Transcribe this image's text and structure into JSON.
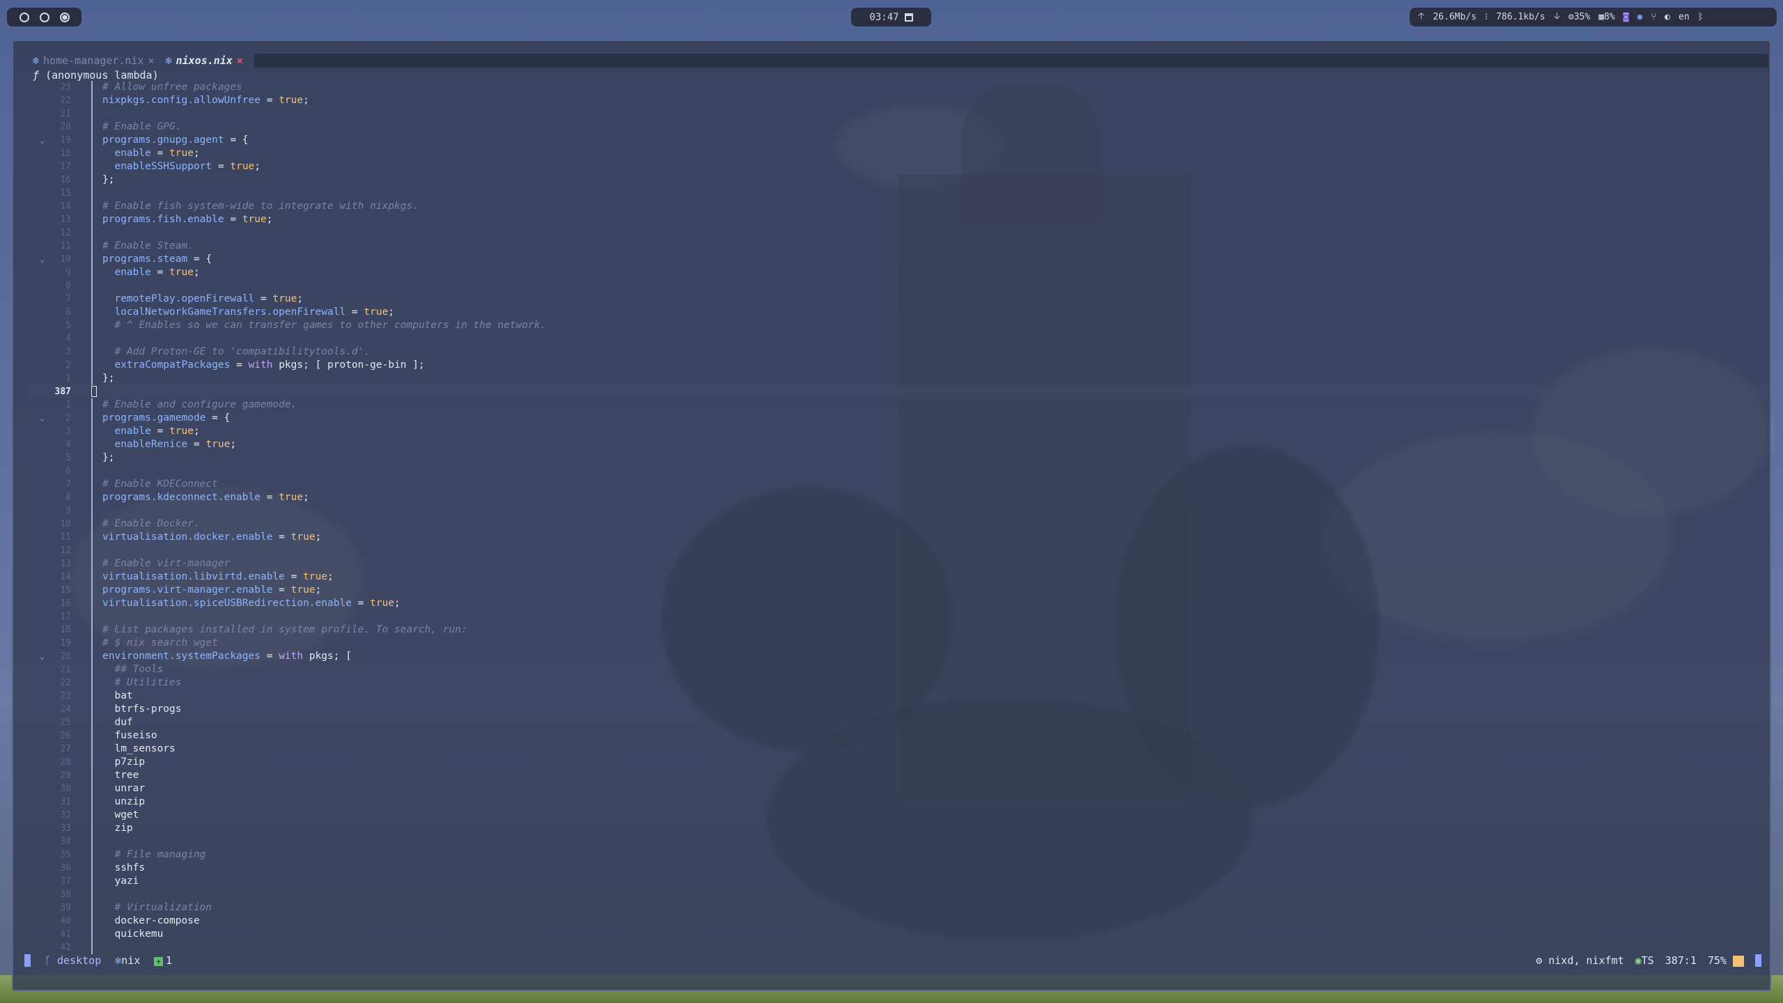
{
  "topbar": {
    "workspaces": [
      "1",
      "2",
      "3"
    ],
    "clock": "03:47",
    "net_up": "26.6Mb/s",
    "net_down": "786.1kb/s",
    "cpu": "35%",
    "mem": "8%",
    "lang": "en"
  },
  "editor": {
    "tabs": [
      {
        "label": "home-manager.nix",
        "close": "×",
        "active": false
      },
      {
        "label": "nixos.nix",
        "close": "×",
        "active": true
      }
    ],
    "winbar_fn": "ƒ",
    "winbar": "(anonymous lambda)",
    "lines": [
      {
        "n": "23",
        "t": [
          [
            "c",
            "# Allow unfree packages"
          ]
        ]
      },
      {
        "n": "22",
        "t": [
          [
            "a",
            "nixpkgs.config.allowUnfree"
          ],
          [
            "o",
            " = "
          ],
          [
            "b",
            "true"
          ],
          [
            "o",
            ";"
          ]
        ]
      },
      {
        "n": "21",
        "t": []
      },
      {
        "n": "20",
        "t": [
          [
            "c",
            "# Enable GPG."
          ]
        ]
      },
      {
        "n": "19",
        "fold": true,
        "t": [
          [
            "a",
            "programs.gnupg.agent"
          ],
          [
            "o",
            " = {"
          ]
        ]
      },
      {
        "n": "18",
        "t": [
          [
            "o",
            "  "
          ],
          [
            "a",
            "enable"
          ],
          [
            "o",
            " = "
          ],
          [
            "b",
            "true"
          ],
          [
            "o",
            ";"
          ]
        ]
      },
      {
        "n": "17",
        "t": [
          [
            "o",
            "  "
          ],
          [
            "a",
            "enableSSHSupport"
          ],
          [
            "o",
            " = "
          ],
          [
            "b",
            "true"
          ],
          [
            "o",
            ";"
          ]
        ]
      },
      {
        "n": "16",
        "t": [
          [
            "o",
            "};"
          ]
        ]
      },
      {
        "n": "15",
        "t": []
      },
      {
        "n": "14",
        "t": [
          [
            "c",
            "# Enable fish system-wide to integrate with nixpkgs."
          ]
        ]
      },
      {
        "n": "13",
        "t": [
          [
            "a",
            "programs.fish.enable"
          ],
          [
            "o",
            " = "
          ],
          [
            "b",
            "true"
          ],
          [
            "o",
            ";"
          ]
        ]
      },
      {
        "n": "12",
        "t": []
      },
      {
        "n": "11",
        "t": [
          [
            "c",
            "# Enable Steam."
          ]
        ]
      },
      {
        "n": "10",
        "fold": true,
        "t": [
          [
            "a",
            "programs.steam"
          ],
          [
            "o",
            " = {"
          ]
        ]
      },
      {
        "n": "9",
        "t": [
          [
            "o",
            "  "
          ],
          [
            "a",
            "enable"
          ],
          [
            "o",
            " = "
          ],
          [
            "b",
            "true"
          ],
          [
            "o",
            ";"
          ]
        ]
      },
      {
        "n": "8",
        "t": []
      },
      {
        "n": "7",
        "t": [
          [
            "o",
            "  "
          ],
          [
            "a",
            "remotePlay.openFirewall"
          ],
          [
            "o",
            " = "
          ],
          [
            "b",
            "true"
          ],
          [
            "o",
            ";"
          ]
        ]
      },
      {
        "n": "6",
        "t": [
          [
            "o",
            "  "
          ],
          [
            "a",
            "localNetworkGameTransfers.openFirewall"
          ],
          [
            "o",
            " = "
          ],
          [
            "b",
            "true"
          ],
          [
            "o",
            ";"
          ]
        ]
      },
      {
        "n": "5",
        "t": [
          [
            "o",
            "  "
          ],
          [
            "c",
            "# ^ Enables so we can transfer games to other computers in the network."
          ]
        ]
      },
      {
        "n": "4",
        "t": []
      },
      {
        "n": "3",
        "t": [
          [
            "o",
            "  "
          ],
          [
            "c",
            "# Add Proton-GE to 'compatibilitytools.d'."
          ]
        ]
      },
      {
        "n": "2",
        "t": [
          [
            "o",
            "  "
          ],
          [
            "a",
            "extraCompatPackages"
          ],
          [
            "o",
            " = "
          ],
          [
            "k",
            "with"
          ],
          [
            "o",
            " pkgs; [ proton-ge-bin ];"
          ]
        ]
      },
      {
        "n": "1",
        "t": [
          [
            "o",
            "};"
          ]
        ]
      },
      {
        "n": "387",
        "current": true,
        "t": []
      },
      {
        "n": "1",
        "t": [
          [
            "c",
            "# Enable and configure gamemode."
          ]
        ]
      },
      {
        "n": "2",
        "fold": true,
        "t": [
          [
            "a",
            "programs.gamemode"
          ],
          [
            "o",
            " = {"
          ]
        ]
      },
      {
        "n": "3",
        "t": [
          [
            "o",
            "  "
          ],
          [
            "a",
            "enable"
          ],
          [
            "o",
            " = "
          ],
          [
            "b",
            "true"
          ],
          [
            "o",
            ";"
          ]
        ]
      },
      {
        "n": "4",
        "t": [
          [
            "o",
            "  "
          ],
          [
            "a",
            "enableRenice"
          ],
          [
            "o",
            " = "
          ],
          [
            "b",
            "true"
          ],
          [
            "o",
            ";"
          ]
        ]
      },
      {
        "n": "5",
        "t": [
          [
            "o",
            "};"
          ]
        ]
      },
      {
        "n": "6",
        "t": []
      },
      {
        "n": "7",
        "t": [
          [
            "c",
            "# Enable KDEConnect"
          ]
        ]
      },
      {
        "n": "8",
        "t": [
          [
            "a",
            "programs.kdeconnect.enable"
          ],
          [
            "o",
            " = "
          ],
          [
            "b",
            "true"
          ],
          [
            "o",
            ";"
          ]
        ]
      },
      {
        "n": "9",
        "t": []
      },
      {
        "n": "10",
        "t": [
          [
            "c",
            "# Enable Docker."
          ]
        ]
      },
      {
        "n": "11",
        "t": [
          [
            "a",
            "virtualisation.docker.enable"
          ],
          [
            "o",
            " = "
          ],
          [
            "b",
            "true"
          ],
          [
            "o",
            ";"
          ]
        ]
      },
      {
        "n": "12",
        "t": []
      },
      {
        "n": "13",
        "t": [
          [
            "c",
            "# Enable virt-manager"
          ]
        ]
      },
      {
        "n": "14",
        "t": [
          [
            "a",
            "virtualisation.libvirtd.enable"
          ],
          [
            "o",
            " = "
          ],
          [
            "b",
            "true"
          ],
          [
            "o",
            ";"
          ]
        ]
      },
      {
        "n": "15",
        "t": [
          [
            "a",
            "programs.virt-manager.enable"
          ],
          [
            "o",
            " = "
          ],
          [
            "b",
            "true"
          ],
          [
            "o",
            ";"
          ]
        ]
      },
      {
        "n": "16",
        "t": [
          [
            "a",
            "virtualisation.spiceUSBRedirection.enable"
          ],
          [
            "o",
            " = "
          ],
          [
            "b",
            "true"
          ],
          [
            "o",
            ";"
          ]
        ]
      },
      {
        "n": "17",
        "t": []
      },
      {
        "n": "18",
        "t": [
          [
            "c",
            "# List packages installed in system profile. To search, run:"
          ]
        ]
      },
      {
        "n": "19",
        "t": [
          [
            "c",
            "# $ nix search wget"
          ]
        ]
      },
      {
        "n": "20",
        "fold": true,
        "t": [
          [
            "a",
            "environment.systemPackages"
          ],
          [
            "o",
            " = "
          ],
          [
            "k",
            "with"
          ],
          [
            "o",
            " pkgs; ["
          ]
        ]
      },
      {
        "n": "21",
        "t": [
          [
            "o",
            "  "
          ],
          [
            "c",
            "## Tools"
          ]
        ]
      },
      {
        "n": "22",
        "t": [
          [
            "o",
            "  "
          ],
          [
            "c",
            "# Utilities"
          ]
        ]
      },
      {
        "n": "23",
        "t": [
          [
            "o",
            "  bat"
          ]
        ]
      },
      {
        "n": "24",
        "t": [
          [
            "o",
            "  btrfs-progs"
          ]
        ]
      },
      {
        "n": "25",
        "t": [
          [
            "o",
            "  duf"
          ]
        ]
      },
      {
        "n": "26",
        "t": [
          [
            "o",
            "  fuseiso"
          ]
        ]
      },
      {
        "n": "27",
        "t": [
          [
            "o",
            "  lm_sensors"
          ]
        ]
      },
      {
        "n": "28",
        "t": [
          [
            "o",
            "  p7zip"
          ]
        ]
      },
      {
        "n": "29",
        "t": [
          [
            "o",
            "  tree"
          ]
        ]
      },
      {
        "n": "30",
        "t": [
          [
            "o",
            "  unrar"
          ]
        ]
      },
      {
        "n": "31",
        "t": [
          [
            "o",
            "  unzip"
          ]
        ]
      },
      {
        "n": "32",
        "t": [
          [
            "o",
            "  wget"
          ]
        ]
      },
      {
        "n": "33",
        "t": [
          [
            "o",
            "  zip"
          ]
        ]
      },
      {
        "n": "34",
        "t": []
      },
      {
        "n": "35",
        "t": [
          [
            "o",
            "  "
          ],
          [
            "c",
            "# File managing"
          ]
        ]
      },
      {
        "n": "36",
        "t": [
          [
            "o",
            "  sshfs"
          ]
        ]
      },
      {
        "n": "37",
        "t": [
          [
            "o",
            "  yazi"
          ]
        ]
      },
      {
        "n": "38",
        "t": []
      },
      {
        "n": "39",
        "t": [
          [
            "o",
            "  "
          ],
          [
            "c",
            "# Virtualization"
          ]
        ]
      },
      {
        "n": "40",
        "t": [
          [
            "o",
            "  docker-compose"
          ]
        ]
      },
      {
        "n": "41",
        "t": [
          [
            "o",
            "  quickemu"
          ]
        ]
      },
      {
        "n": "42",
        "t": []
      }
    ]
  },
  "statusline": {
    "branch": "desktop",
    "filetype": "nix",
    "diag_count": "1",
    "lsp": "nixd, nixfmt",
    "ts": "TS",
    "position": "387:1",
    "percent": "75%"
  }
}
